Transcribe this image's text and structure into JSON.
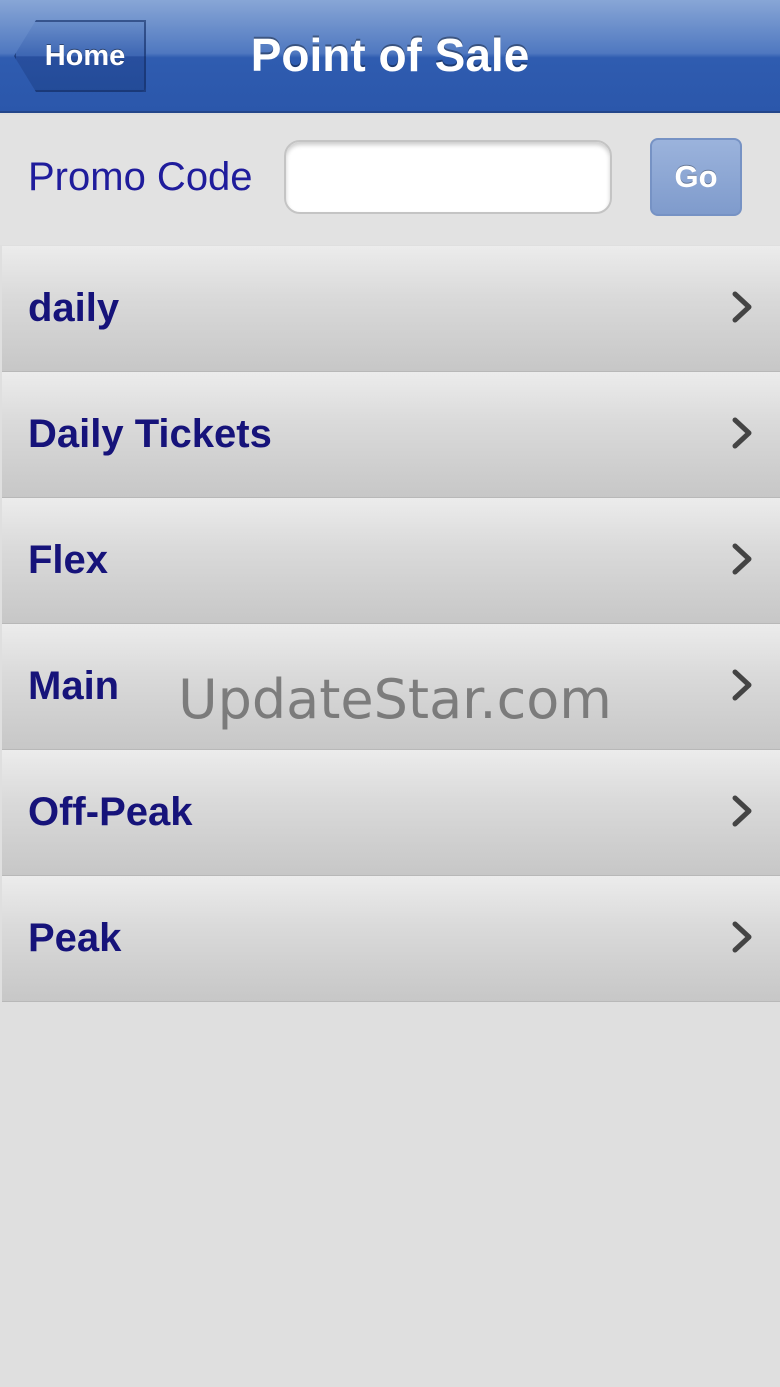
{
  "navbar": {
    "back_label": "Home",
    "title": "Point of Sale"
  },
  "promo": {
    "label": "Promo Code",
    "value": "",
    "placeholder": "",
    "go_label": "Go"
  },
  "list": {
    "items": [
      {
        "label": "daily"
      },
      {
        "label": "Daily Tickets"
      },
      {
        "label": "Flex"
      },
      {
        "label": "Main"
      },
      {
        "label": "Off-Peak"
      },
      {
        "label": "Peak"
      }
    ]
  },
  "watermark": "UpdateStar.com",
  "colors": {
    "navbar": "#2f5cb0",
    "label_text": "#16137a",
    "promo_label": "#1f1c9c",
    "background": "#dfdfdf"
  },
  "icons": {
    "row_disclosure": "chevron-right-icon"
  }
}
